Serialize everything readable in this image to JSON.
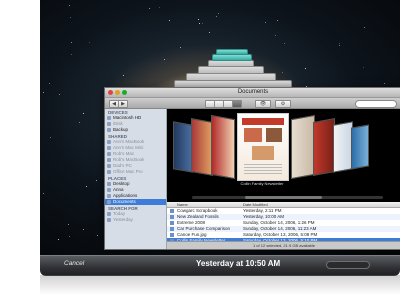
{
  "window": {
    "title": "Documents",
    "search_placeholder": ""
  },
  "sidebar": {
    "sections": [
      {
        "header": "DEVICES",
        "items": [
          {
            "label": "Macintosh HD",
            "dim": false,
            "selected": false
          },
          {
            "label": "iDisk",
            "dim": true,
            "selected": false
          },
          {
            "label": "Backup",
            "dim": false,
            "selected": false
          }
        ]
      },
      {
        "header": "SHARED",
        "items": [
          {
            "label": "Ann's MacBook",
            "dim": true,
            "selected": false
          },
          {
            "label": "Ann's Mac Mini",
            "dim": true,
            "selected": false
          },
          {
            "label": "Rob's Mac",
            "dim": true,
            "selected": false
          },
          {
            "label": "Rob's MacBook",
            "dim": true,
            "selected": false
          },
          {
            "label": "Dad's PC",
            "dim": true,
            "selected": false
          },
          {
            "label": "Office Mac Pro",
            "dim": true,
            "selected": false
          }
        ]
      },
      {
        "header": "PLACES",
        "items": [
          {
            "label": "Desktop",
            "dim": false,
            "selected": false
          },
          {
            "label": "Anna",
            "dim": false,
            "selected": false
          },
          {
            "label": "Applications",
            "dim": false,
            "selected": false
          },
          {
            "label": "Documents",
            "dim": false,
            "selected": true
          }
        ]
      },
      {
        "header": "SEARCH FOR",
        "items": [
          {
            "label": "Today",
            "dim": true,
            "selected": false
          },
          {
            "label": "Yesterday",
            "dim": true,
            "selected": false
          }
        ]
      }
    ]
  },
  "list": {
    "headers": {
      "name": "Name",
      "date": "Date Modified"
    },
    "rows": [
      {
        "name": "Cowgarc Scrapbook",
        "date": "Yesterday, 2:11 PM",
        "selected": false
      },
      {
        "name": "New Zealand Fossils",
        "date": "Yesterday, 10:00 AM",
        "selected": false
      },
      {
        "name": "Extreme 2008",
        "date": "Sunday, October 14, 2006, 1:26 PM",
        "selected": false
      },
      {
        "name": "Car Purchase Comparison",
        "date": "Sunday, October 14, 2006, 11:23 AM",
        "selected": false
      },
      {
        "name": "Canoe Fun.jpg",
        "date": "Saturday, October 13, 2006, 5:08 PM",
        "selected": false
      },
      {
        "name": "Collin Family Newsletter",
        "date": "Saturday, October 13, 2006, 5:10 PM",
        "selected": true
      }
    ]
  },
  "status": "1 of 12 selected, 21.9 GB available",
  "coverflow": {
    "caption": "Collin Family Newsletter"
  },
  "timemachine": {
    "cancel_label": "Cancel",
    "when_label": "Yesterday at 10:50 AM"
  }
}
